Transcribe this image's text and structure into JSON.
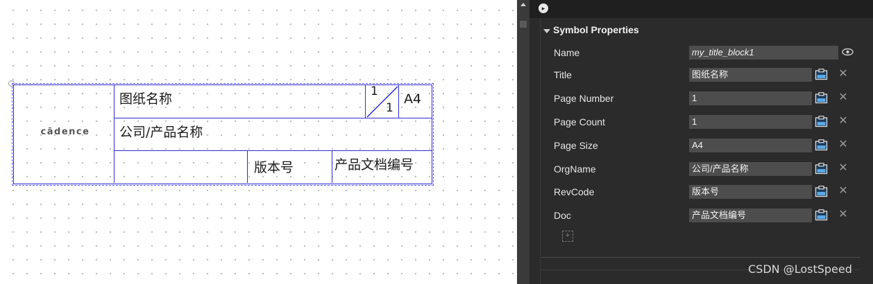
{
  "title_block": {
    "logo": "cādence",
    "drawing_name": "图纸名称",
    "page_number": "1",
    "page_count": "1",
    "page_size": "A4",
    "org_name": "公司/产品名称",
    "rev_code": "版本号",
    "doc": "产品文档编号"
  },
  "panel": {
    "section_title": "Symbol Properties",
    "rows": [
      {
        "label": "Name",
        "value": "my_title_block1",
        "trailing_icon": "eye-icon"
      },
      {
        "label": "Title",
        "value": "图纸名称",
        "trailing_icon": "clipboard-icon"
      },
      {
        "label": "Page Number",
        "value": "1",
        "trailing_icon": "clipboard-icon"
      },
      {
        "label": "Page Count",
        "value": "1",
        "trailing_icon": "clipboard-icon"
      },
      {
        "label": "Page Size",
        "value": "A4",
        "trailing_icon": "clipboard-icon"
      },
      {
        "label": "OrgName",
        "value": "公司/产品名称",
        "trailing_icon": "clipboard-icon"
      },
      {
        "label": "RevCode",
        "value": "版本号",
        "trailing_icon": "clipboard-icon"
      },
      {
        "label": "Doc",
        "value": "产品文档编号",
        "trailing_icon": "clipboard-icon"
      }
    ],
    "add_icon": "add-property-icon"
  },
  "watermark": "CSDN @LostSpeed",
  "colors": {
    "block_line": "#2b2bd0",
    "panel_bg": "#2b2b2b",
    "field_bg": "#4d4d4d",
    "clipboard_accent": "#5aa9e6"
  }
}
